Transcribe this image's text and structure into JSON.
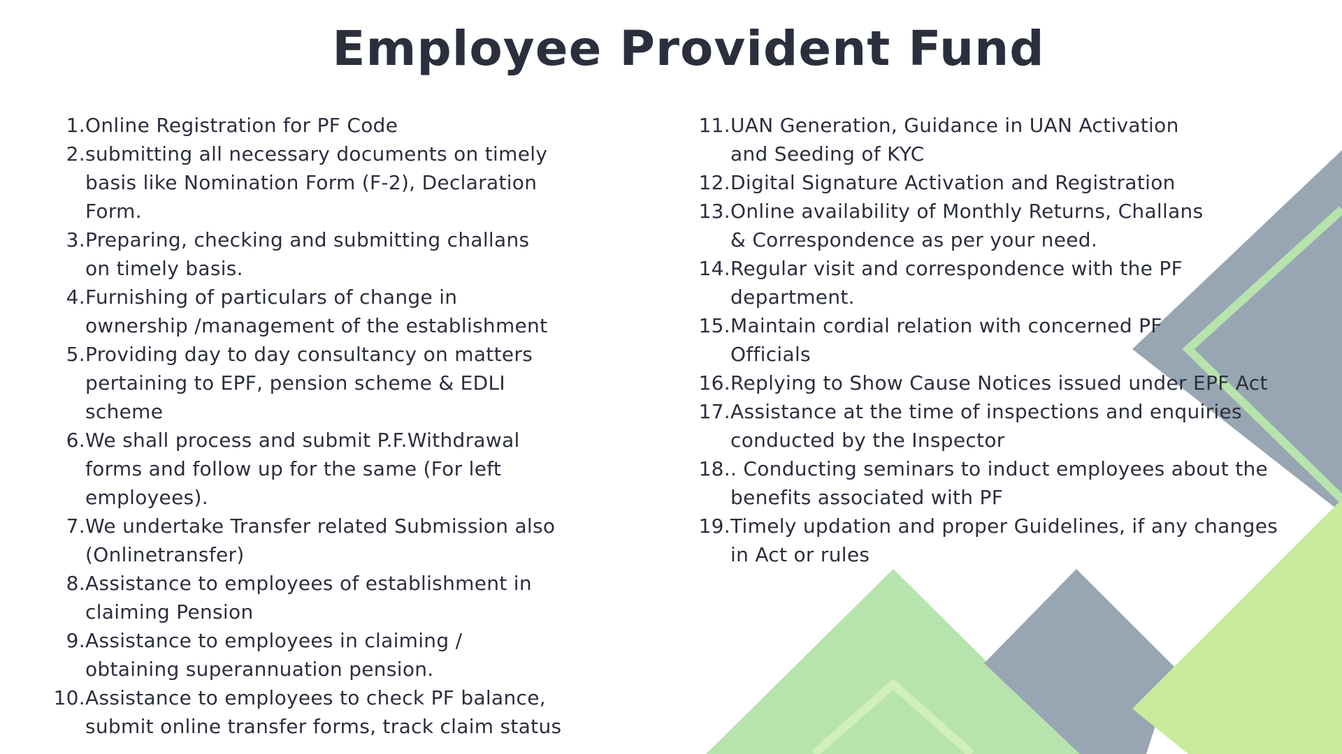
{
  "title": "Employee Provident Fund",
  "colors": {
    "text": "#2b2f3d",
    "slate": "#98a6b3",
    "green_light": "#b7e4ad",
    "green_bright": "#c8ec9c"
  },
  "left_items": [
    {
      "num": "1.",
      "text": "Online Registration for PF Code"
    },
    {
      "num": "2.",
      "text": "submitting all necessary documents on timely\nbasis like Nomination  Form (F-2), Declaration\nForm."
    },
    {
      "num": "3.",
      "text": "Preparing, checking and submitting challans\non timely basis."
    },
    {
      "num": "4.",
      "text": "Furnishing of particulars of change in\nownership /management of the establishment"
    },
    {
      "num": "5.",
      "text": " Providing day to day consultancy on matters\npertaining to EPF, pension scheme & EDLI\nscheme"
    },
    {
      "num": "6.",
      "text": "We shall process and submit P.F.Withdrawal\nforms and follow up for the same (For left\nemployees)."
    },
    {
      "num": "7.",
      "text": "We undertake Transfer related Submission also\n(Onlinetransfer)"
    },
    {
      "num": "8.",
      "text": "Assistance to employees of establishment in\nclaiming Pension"
    },
    {
      "num": "9.",
      "text": " Assistance to employees in claiming /\nobtaining superannuation pension."
    },
    {
      "num": "10.",
      "text": "Assistance to employees to check PF balance,\nsubmit online transfer forms, track claim status"
    }
  ],
  "right_items": [
    {
      "num": "11.",
      "text": "UAN Generation, Guidance in UAN Activation\nand Seeding of KYC"
    },
    {
      "num": "12.",
      "text": "Digital Signature Activation and Registration"
    },
    {
      "num": "13.",
      "text": "Online availability of Monthly  Returns, Challans\n& Correspondence as per your need."
    },
    {
      "num": "14.",
      "text": "Regular visit and correspondence with the PF\ndepartment."
    },
    {
      "num": "15.",
      "text": "Maintain cordial relation with concerned PF\nOfficials"
    },
    {
      "num": "16.",
      "text": "Replying to Show Cause Notices issued under EPF Act"
    },
    {
      "num": "17.",
      "text": "Assistance at the time of inspections and enquiries\nconducted by the Inspector"
    },
    {
      "num": "18.",
      "text": ". Conducting  seminars to induct employees about the\n benefits associated with PF"
    },
    {
      "num": "19.",
      "text": "Timely updation and proper Guidelines, if any changes\n in Act or rules"
    }
  ]
}
